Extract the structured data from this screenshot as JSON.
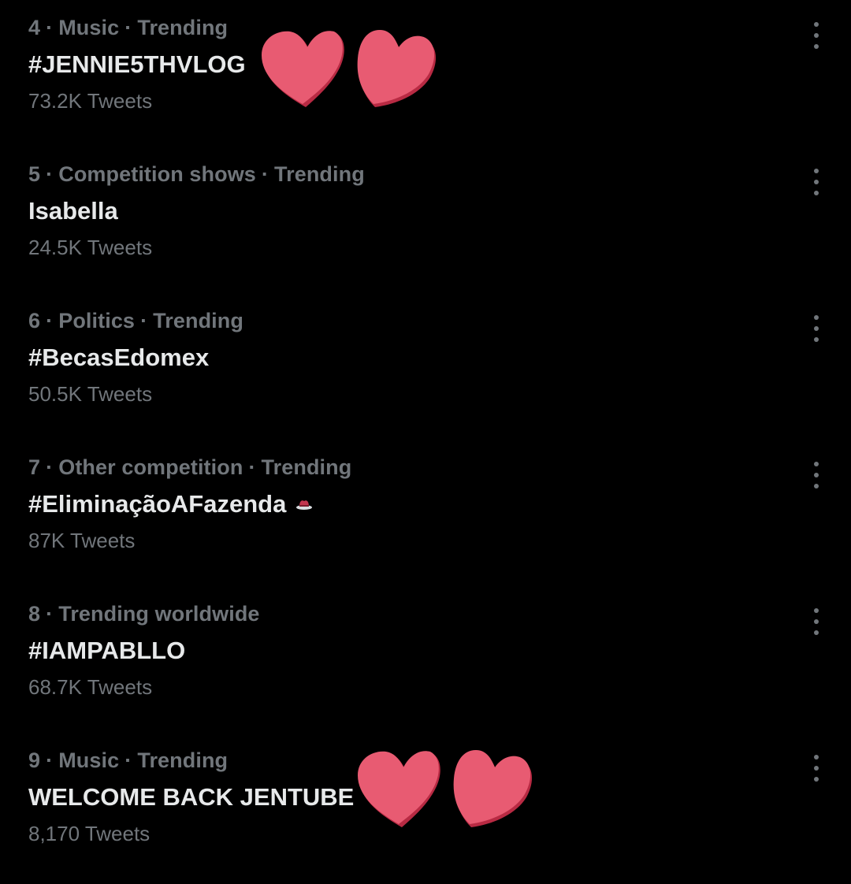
{
  "colors": {
    "background": "#000000",
    "text_primary": "#e7e9ea",
    "text_secondary": "#71767b",
    "heart_fill": "#e85b72",
    "heart_shadow": "#b82a43"
  },
  "icons": {
    "more": "more-vertical-icon",
    "heart": "heart-sticker-icon",
    "hat": "cowboy-hat-emoji"
  },
  "trends": [
    {
      "rank": "4",
      "meta": [
        "Music",
        "Trending"
      ],
      "title": "#JENNIE5THVLOG",
      "count": "73.2K Tweets"
    },
    {
      "rank": "5",
      "meta": [
        "Competition shows",
        "Trending"
      ],
      "title": "Isabella",
      "count": "24.5K Tweets"
    },
    {
      "rank": "6",
      "meta": [
        "Politics",
        "Trending"
      ],
      "title": "#BecasEdomex",
      "count": "50.5K Tweets"
    },
    {
      "rank": "7",
      "meta": [
        "Other competition",
        "Trending"
      ],
      "title": "#EliminaçãoAFazenda",
      "count": "87K Tweets"
    },
    {
      "rank": "8",
      "meta": [
        "Trending worldwide"
      ],
      "title": "#IAMPABLLO",
      "count": "68.7K Tweets"
    },
    {
      "rank": "9",
      "meta": [
        "Music",
        "Trending"
      ],
      "title": "WELCOME BACK JENTUBE",
      "count": "8,170 Tweets"
    }
  ]
}
